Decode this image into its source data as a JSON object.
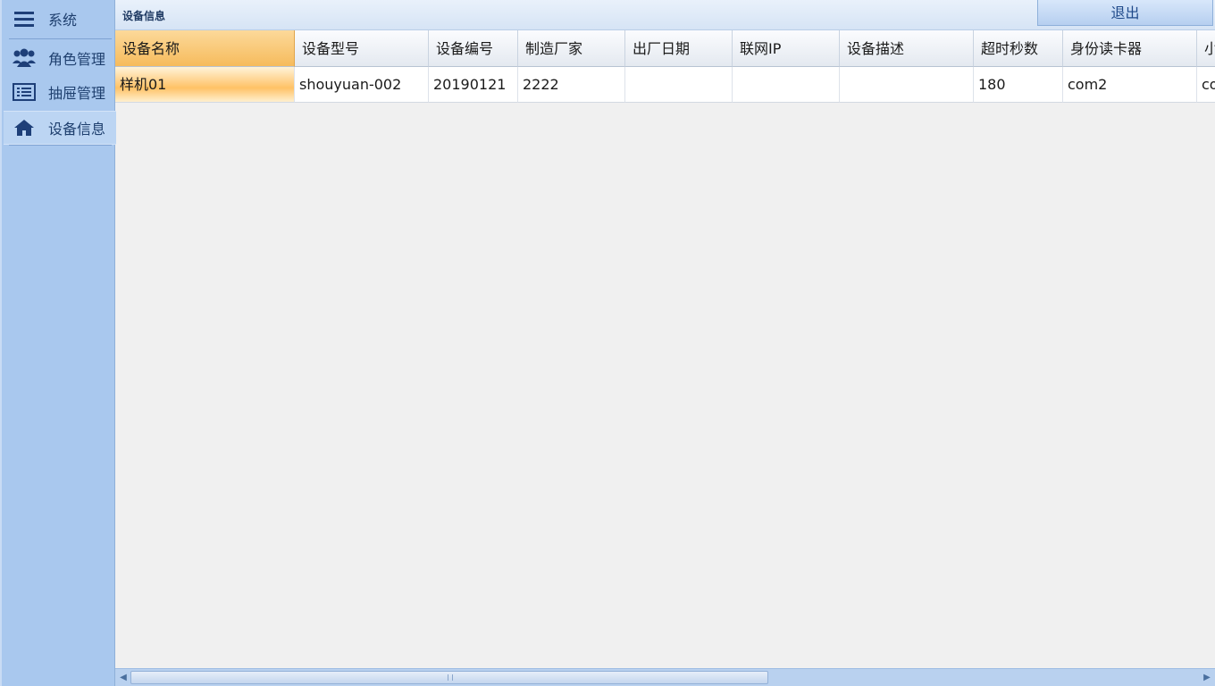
{
  "sidebar": {
    "items": [
      {
        "label": "系统",
        "icon": "menu-icon"
      },
      {
        "label": "角色管理",
        "icon": "users-icon"
      },
      {
        "label": "抽屉管理",
        "icon": "list-icon"
      },
      {
        "label": "设备信息",
        "icon": "home-icon",
        "active": true
      }
    ]
  },
  "header": {
    "title": "设备信息",
    "exit_label": "退出"
  },
  "table": {
    "columns": [
      "设备名称",
      "设备型号",
      "设备编号",
      "制造厂家",
      "出厂日期",
      "联网IP",
      "设备描述",
      "超时秒数",
      "身份读卡器",
      "小"
    ],
    "rows": [
      [
        "样机01",
        "shouyuan-002",
        "20190121",
        "2222",
        "",
        "",
        "",
        "180",
        "com2",
        "co"
      ]
    ]
  },
  "colors": {
    "sidebar_bg": "#a9c8ee",
    "selected_header": "#f6bb5c",
    "accent_text": "#1e3f6e"
  }
}
